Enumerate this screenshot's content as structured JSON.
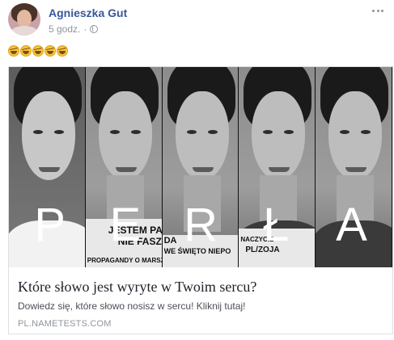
{
  "post": {
    "author": "Agnieszka Gut",
    "timestamp": "5 godz.",
    "separator": "·",
    "privacy_icon": "globe-icon",
    "emoji_icon": "rolling-on-floor-laughing-emoji",
    "emoji_count": 5
  },
  "link": {
    "image_letters": [
      "P",
      "E",
      "R",
      "Ł",
      "A"
    ],
    "sign_texts": {
      "panel2_line1": "JESTEM PAT",
      "panel2_line2": "NIE FASZ",
      "panel2_line3": "PROPAGANDY O MARSZU",
      "panel3_line1": "DA",
      "panel3_line2": "WE ŚWIĘTO NIEPO",
      "panel5_line1": "NACZYCIE",
      "panel5_line2": "PL/ZOJA"
    },
    "title": "Które słowo jest wyryte w Twoim sercu?",
    "description": "Dowiedz się, które słowo nosisz w sercu! Kliknij tutaj!",
    "domain": "PL.NAMETESTS.COM"
  },
  "colors": {
    "author_link": "#365899",
    "meta_gray": "#90949c",
    "border": "#dddfe2"
  }
}
